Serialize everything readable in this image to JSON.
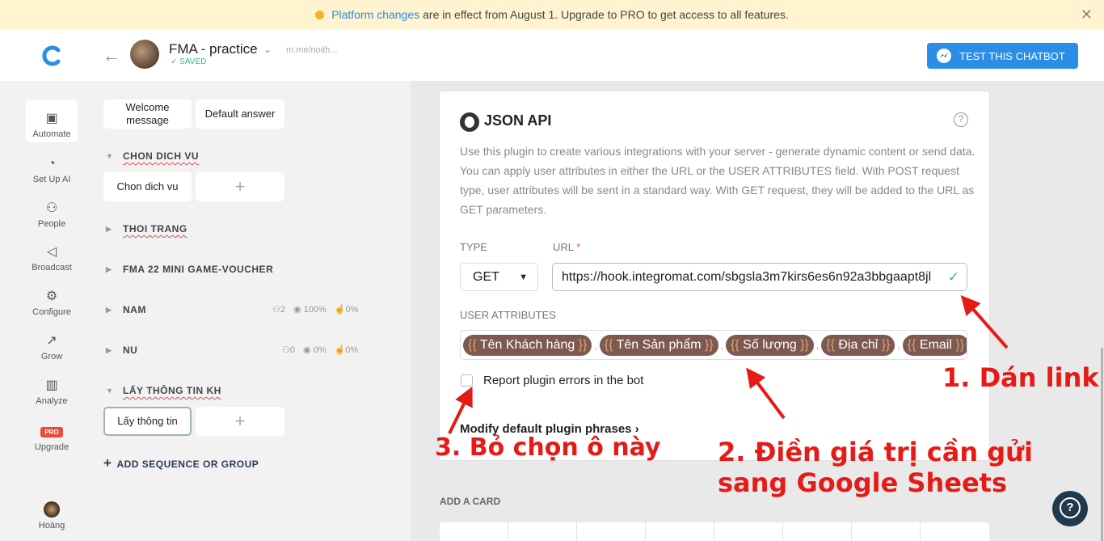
{
  "banner": {
    "link_text": "Platform changes",
    "message": "are in effect from August 1. Upgrade to PRO to get access to all features.",
    "close": "✕"
  },
  "header": {
    "bot_name": "FMA - practice",
    "saved": "SAVED",
    "bot_link": "m.me/noith...",
    "test_button": "TEST THIS CHATBOT"
  },
  "nav": [
    {
      "label": "Automate",
      "icon": "robot-icon"
    },
    {
      "label": "Set Up AI",
      "icon": "brain-icon"
    },
    {
      "label": "People",
      "icon": "people-icon"
    },
    {
      "label": "Broadcast",
      "icon": "megaphone-icon"
    },
    {
      "label": "Configure",
      "icon": "gear-icon"
    },
    {
      "label": "Grow",
      "icon": "growth-icon"
    },
    {
      "label": "Analyze",
      "icon": "bar-chart-icon"
    },
    {
      "label": "Upgrade",
      "badge": "PRO"
    },
    {
      "label": "Hoàng",
      "icon": "user-avatar"
    }
  ],
  "groups": {
    "top_chips": [
      "Welcome\nmessage",
      "Default answer"
    ],
    "plus": "+",
    "list": [
      {
        "title": "CHON DICH VU",
        "expanded": true,
        "chip": "Chon dich vu"
      },
      {
        "title": "THOI TRANG",
        "expanded": false
      },
      {
        "title": "FMA 22 MINI GAME-VOUCHER",
        "expanded": false
      },
      {
        "title": "NAM",
        "expanded": false,
        "users": "2",
        "views": "100%",
        "clicks": "0%"
      },
      {
        "title": "NU",
        "expanded": false,
        "users": "0",
        "views": "0%",
        "clicks": "0%"
      },
      {
        "title": "LẤY THÔNG TIN KH",
        "expanded": true,
        "chip": "Lấy thông tin"
      }
    ],
    "add_sequence": "ADD SEQUENCE OR GROUP"
  },
  "plugin": {
    "title": "JSON API",
    "description": "Use this plugin to create various integrations with your server - generate dynamic content or send data. You can apply user attributes in either the URL or the USER ATTRIBUTES field. With POST request type, user attributes will be sent in a standard way. With GET request, they will be added to the URL as GET parameters.",
    "type_label": "TYPE",
    "type_value": "GET",
    "url_label": "URL",
    "url_required": "*",
    "url_value": "https://hook.integromat.com/sbgsla3m7kirs6es6n92a3bbgaapt8jl",
    "attrs_label": "USER ATTRIBUTES",
    "attributes": [
      "Tên Khách hàng",
      "Tên Sản phẩm",
      "Số lượng",
      "Địa chỉ",
      "Email"
    ],
    "report_errors": "Report plugin errors in the bot",
    "modify_phrases": "Modify default plugin phrases"
  },
  "add_card": "ADD A CARD",
  "annotations": {
    "step1": "1. Dán link",
    "step2_line1": "2. Điền giá trị cần gửi",
    "step2_line2": "sang Google Sheets",
    "step3": "3. Bỏ chọn ô này"
  },
  "colors": {
    "accent": "#2a8de6",
    "attribute_chip": "#7d5a4f",
    "annotation": "#e41b17",
    "success": "#3cb878"
  }
}
